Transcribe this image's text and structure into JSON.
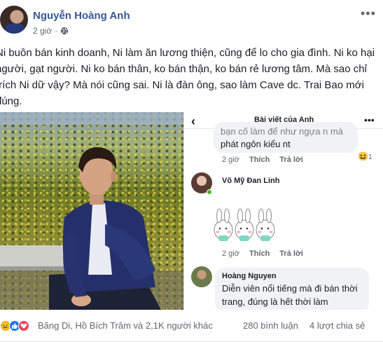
{
  "post": {
    "author": "Nguyễn Hoàng Anh",
    "time": "2 giờ",
    "privacy_icon": "globe-icon",
    "more_label": "•••",
    "text": "Ni buôn bán kinh doanh, Ni làm ăn lương thiện, cũng để lo cho gia đình. Ni ko hại người, gạt người. Ni ko bán thân, ko bán thận, ko bán rẻ lương tâm. Mà sao chỉ trích Ni dữ vậy? Mà nói cũng sai. Ni là đàn ông, sao làm Cave dc. Trai Bao mới đúng."
  },
  "screenshot": {
    "back_label": "‹",
    "title": "Bài viết của Anh",
    "more_label": "•••",
    "comments": [
      {
        "name": "",
        "text_partial": "bạn cố làm để như ngựa n mà",
        "text": "phát ngôn kiểu nt",
        "time": "2 giờ",
        "like_label": "Thích",
        "reply_label": "Trả lời",
        "reaction_count": "1"
      },
      {
        "name": "Võ Mỹ Đan Linh",
        "time": "2 giờ",
        "like_label": "Thích",
        "reply_label": "Trả lời"
      },
      {
        "name": "Hoàng Nguyen",
        "text": "Diễn viên nổi tiếng mà đi bán thời trang, đúng là hết thời làm"
      }
    ]
  },
  "footer": {
    "reactions": [
      "haha-icon",
      "like-icon",
      "love-icon"
    ],
    "names": "Băng Di, Hồ Bích Trâm và 2,1K người khác",
    "comments": "280 bình luận",
    "shares": "4 lượt chia sẻ"
  }
}
